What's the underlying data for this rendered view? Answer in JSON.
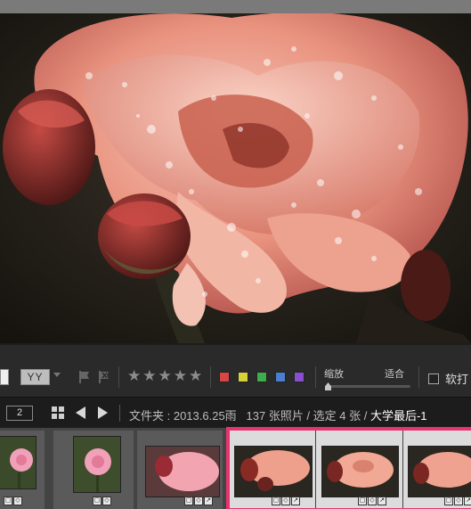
{
  "toolbar": {
    "view_buttons": [
      "YY"
    ],
    "rating_stars": "★★★★★",
    "color_labels": [
      "#d84545",
      "#d8d23a",
      "#3dae4a",
      "#4a7fd0",
      "#8a4fcf"
    ],
    "zoom_label": "缩放",
    "fit_label": "适合",
    "soft_proof_label": "软打"
  },
  "filmstrip_header": {
    "secondary_display": "2",
    "folder_text": "文件夹 : 2013.6.25雨",
    "photo_count_text": "137 张照片 / 选定 4 张 /",
    "selected_name": "大学最后-1"
  },
  "filmstrip": {
    "thumbnails": [
      {
        "orientation": "portrait",
        "selected": false
      },
      {
        "orientation": "portrait",
        "selected": false
      },
      {
        "orientation": "landscape",
        "selected": false
      },
      {
        "orientation": "landscape",
        "selected": true
      },
      {
        "orientation": "landscape",
        "selected": true
      },
      {
        "orientation": "landscape",
        "selected": true
      }
    ],
    "selection_color": "#e8336f"
  },
  "icons": [
    "single-view-icon",
    "compare-view-icon",
    "flag-icon",
    "reject-flag-icon",
    "star-icon",
    "grid-icon",
    "arrow-left-icon",
    "arrow-right-icon",
    "badge-icon"
  ]
}
